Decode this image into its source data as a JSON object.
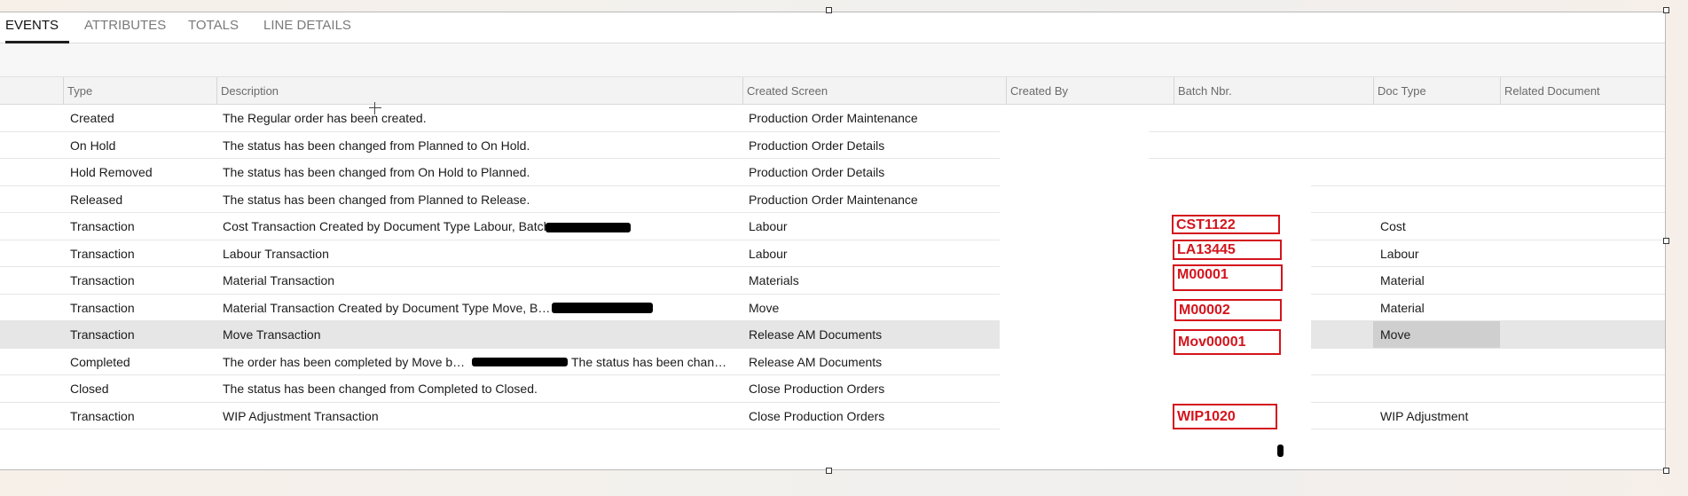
{
  "tabs": [
    {
      "label": "EVENTS",
      "active": true
    },
    {
      "label": "ATTRIBUTES",
      "active": false
    },
    {
      "label": "TOTALS",
      "active": false
    },
    {
      "label": "LINE DETAILS",
      "active": false
    }
  ],
  "columns": {
    "type": "Type",
    "description": "Description",
    "created_screen": "Created Screen",
    "created_by": "Created By",
    "batch_nbr": "Batch Nbr.",
    "doc_type": "Doc Type",
    "related_document": "Related Document"
  },
  "rows": [
    {
      "type": "Created",
      "description": "The Regular order has been created.",
      "created_screen": "Production Order Maintenance",
      "batch": "",
      "doc_type": ""
    },
    {
      "type": "On Hold",
      "description": "The status has been changed from Planned to On Hold.",
      "created_screen": "Production Order Details",
      "batch": "",
      "doc_type": ""
    },
    {
      "type": "Hold Removed",
      "description": "The status has been changed from On Hold to Planned.",
      "created_screen": "Production Order Details",
      "batch": "",
      "doc_type": ""
    },
    {
      "type": "Released",
      "description": "The status has been changed from Planned to Release.",
      "created_screen": "Production Order Maintenance",
      "batch": "",
      "doc_type": ""
    },
    {
      "type": "Transaction",
      "description": "Cost Transaction Created by Document Type Labour, Batch",
      "created_screen": "Labour",
      "batch": "CST1122",
      "doc_type": "Cost"
    },
    {
      "type": "Transaction",
      "description": "Labour Transaction",
      "created_screen": "Labour",
      "batch": "LA13445",
      "doc_type": "Labour"
    },
    {
      "type": "Transaction",
      "description": "Material Transaction",
      "created_screen": "Materials",
      "batch": "M00001",
      "doc_type": "Material"
    },
    {
      "type": "Transaction",
      "description": "Material Transaction Created by Document Type Move, Batch",
      "created_screen": "Move",
      "batch": "M00002",
      "doc_type": "Material"
    },
    {
      "type": "Transaction",
      "description": "Move Transaction",
      "created_screen": "Release AM Documents",
      "batch": "Mov00001",
      "doc_type": "Move"
    },
    {
      "type": "Completed",
      "description": "The order has been completed by Move batch",
      "description_tail": "The status has been chang...",
      "created_screen": "Release AM Documents",
      "batch": "",
      "doc_type": ""
    },
    {
      "type": "Closed",
      "description": "The status has been changed from Completed to Closed.",
      "created_screen": "Close Production Orders",
      "batch": "",
      "doc_type": ""
    },
    {
      "type": "Transaction",
      "description": "WIP Adjustment Transaction",
      "created_screen": "Close Production Orders",
      "batch": "WIP1020",
      "doc_type": "WIP Adjustment"
    }
  ],
  "selected_row_index": 8,
  "colors": {
    "annotation_red": "#d4141c",
    "selected_row": "#e6e6e6"
  }
}
